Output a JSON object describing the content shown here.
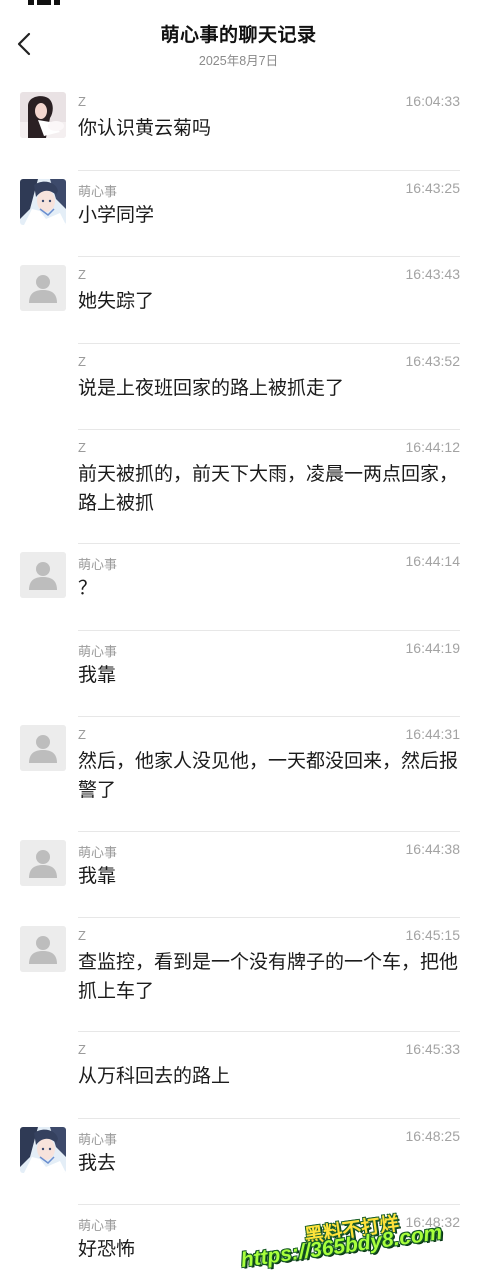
{
  "header": {
    "title": "萌心事的聊天记录",
    "date": "2025年8月7日"
  },
  "icons": {
    "back": "chevron-left-icon",
    "default_avatar": "person-silhouette-icon"
  },
  "colors": {
    "watermark_text": "#ffe23a",
    "watermark_url": "#a8ff3c",
    "watermark_outline": "#1a5f2a"
  },
  "messages": [
    {
      "sender": "Z",
      "time": "16:04:33",
      "text": "你认识黄云菊吗",
      "avatar": "photo-girl"
    },
    {
      "sender": "萌心事",
      "time": "16:43:25",
      "text": "小学同学",
      "avatar": "photo-anime"
    },
    {
      "sender": "Z",
      "time": "16:43:43",
      "text": "她失踪了",
      "avatar": "default"
    },
    {
      "sender": "Z",
      "time": "16:43:52",
      "text": "说是上夜班回家的路上被抓走了",
      "avatar": "none"
    },
    {
      "sender": "Z",
      "time": "16:44:12",
      "text": "前天被抓的，前天下大雨，凌晨一两点回家，路上被抓",
      "avatar": "none"
    },
    {
      "sender": "萌心事",
      "time": "16:44:14",
      "text": "？",
      "avatar": "default"
    },
    {
      "sender": "萌心事",
      "time": "16:44:19",
      "text": "我靠",
      "avatar": "none"
    },
    {
      "sender": "Z",
      "time": "16:44:31",
      "text": "然后，他家人没见他，一天都没回来，然后报警了",
      "avatar": "default"
    },
    {
      "sender": "萌心事",
      "time": "16:44:38",
      "text": "我靠",
      "avatar": "default"
    },
    {
      "sender": "Z",
      "time": "16:45:15",
      "text": "查监控，看到是一个没有牌子的一个车，把他抓上车了",
      "avatar": "default"
    },
    {
      "sender": "Z",
      "time": "16:45:33",
      "text": "从万科回去的路上",
      "avatar": "none"
    },
    {
      "sender": "萌心事",
      "time": "16:48:25",
      "text": "我去",
      "avatar": "photo-anime"
    },
    {
      "sender": "萌心事",
      "time": "16:48:32",
      "text": "好恐怖",
      "avatar": "none"
    }
  ],
  "watermark": {
    "line1": "黑料不打烊",
    "line2": "https://365bdy8.com"
  }
}
